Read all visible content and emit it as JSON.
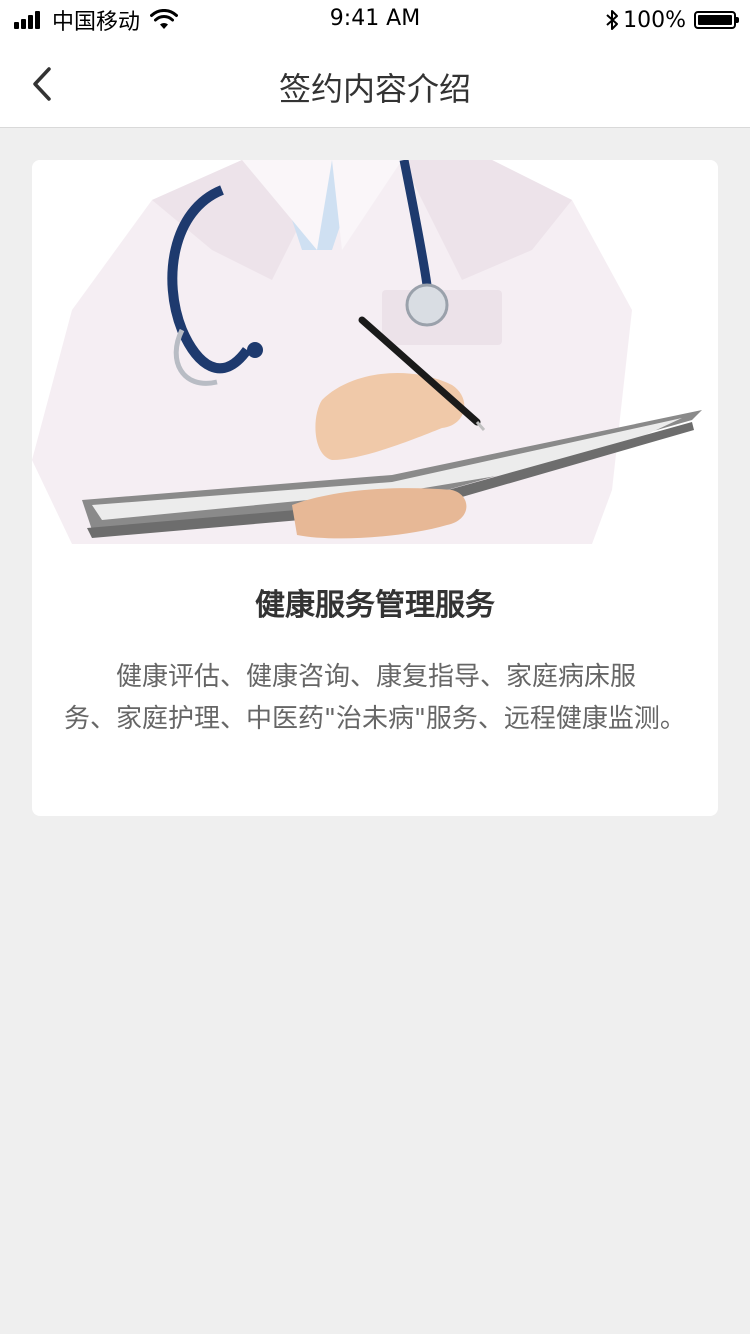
{
  "status_bar": {
    "carrier": "中国移动",
    "time": "9:41 AM",
    "battery": "100%",
    "icons": [
      "signal-icon",
      "wifi-icon",
      "bluetooth-icon",
      "battery-icon"
    ]
  },
  "nav": {
    "title": "签约内容介绍",
    "back_icon": "chevron-left-icon"
  },
  "card": {
    "image": "doctor-photo",
    "title": "健康服务管理服务",
    "description": "健康评估、健康咨询、康复指导、家庭病床服务、家庭护理、中医药\"治未病\"服务、远程健康监测。"
  },
  "colors": {
    "background": "#efefef",
    "card": "#ffffff",
    "title_text": "#333333",
    "body_text": "#666666"
  }
}
